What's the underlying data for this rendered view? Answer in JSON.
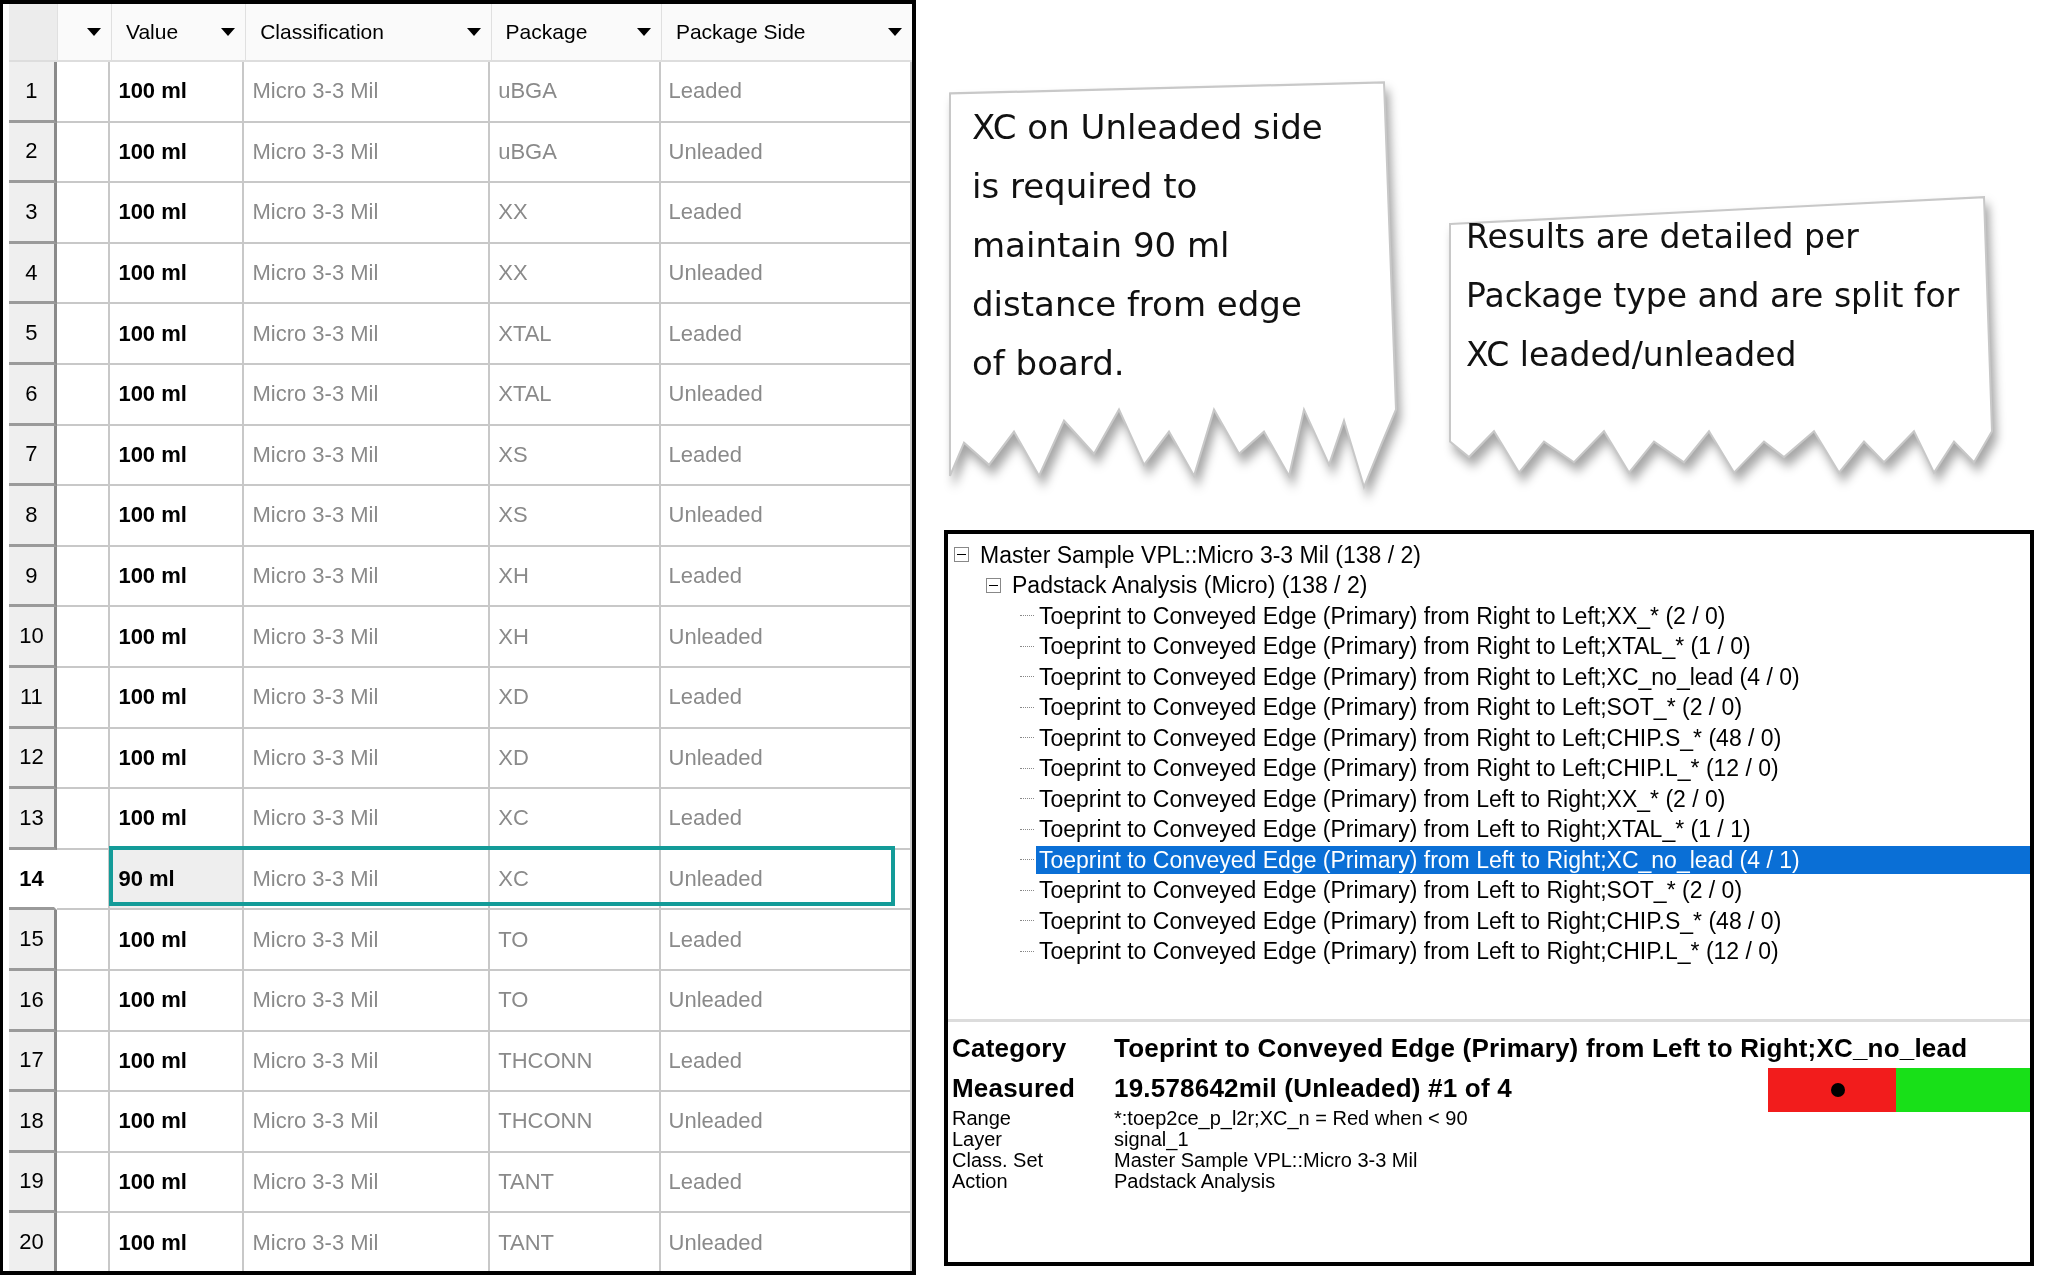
{
  "table": {
    "columns": [
      {
        "label": "Value"
      },
      {
        "label": "Classification"
      },
      {
        "label": "Package"
      },
      {
        "label": "Package Side"
      }
    ],
    "rows": [
      {
        "number": "1",
        "value": "100 ml",
        "classification": "Micro 3-3 Mil",
        "package": "uBGA",
        "side": "Leaded",
        "selected": false
      },
      {
        "number": "2",
        "value": "100 ml",
        "classification": "Micro 3-3 Mil",
        "package": "uBGA",
        "side": "Unleaded",
        "selected": false
      },
      {
        "number": "3",
        "value": "100 ml",
        "classification": "Micro 3-3 Mil",
        "package": "XX",
        "side": "Leaded",
        "selected": false
      },
      {
        "number": "4",
        "value": "100 ml",
        "classification": "Micro 3-3 Mil",
        "package": "XX",
        "side": "Unleaded",
        "selected": false
      },
      {
        "number": "5",
        "value": "100 ml",
        "classification": "Micro 3-3 Mil",
        "package": "XTAL",
        "side": "Leaded",
        "selected": false
      },
      {
        "number": "6",
        "value": "100 ml",
        "classification": "Micro 3-3 Mil",
        "package": "XTAL",
        "side": "Unleaded",
        "selected": false
      },
      {
        "number": "7",
        "value": "100 ml",
        "classification": "Micro 3-3 Mil",
        "package": "XS",
        "side": "Leaded",
        "selected": false
      },
      {
        "number": "8",
        "value": "100 ml",
        "classification": "Micro 3-3 Mil",
        "package": "XS",
        "side": "Unleaded",
        "selected": false
      },
      {
        "number": "9",
        "value": "100 ml",
        "classification": "Micro 3-3 Mil",
        "package": "XH",
        "side": "Leaded",
        "selected": false
      },
      {
        "number": "10",
        "value": "100 ml",
        "classification": "Micro 3-3 Mil",
        "package": "XH",
        "side": "Unleaded",
        "selected": false
      },
      {
        "number": "11",
        "value": "100 ml",
        "classification": "Micro 3-3 Mil",
        "package": "XD",
        "side": "Leaded",
        "selected": false
      },
      {
        "number": "12",
        "value": "100 ml",
        "classification": "Micro 3-3 Mil",
        "package": "XD",
        "side": "Unleaded",
        "selected": false
      },
      {
        "number": "13",
        "value": "100 ml",
        "classification": "Micro 3-3 Mil",
        "package": "XC",
        "side": "Leaded",
        "selected": false
      },
      {
        "number": "14",
        "value": "90 ml",
        "classification": "Micro 3-3 Mil",
        "package": "XC",
        "side": "Unleaded",
        "selected": true,
        "outlined": true
      },
      {
        "number": "15",
        "value": "100 ml",
        "classification": "Micro 3-3 Mil",
        "package": "TO",
        "side": "Leaded",
        "selected": false
      },
      {
        "number": "16",
        "value": "100 ml",
        "classification": "Micro 3-3 Mil",
        "package": "TO",
        "side": "Unleaded",
        "selected": false
      },
      {
        "number": "17",
        "value": "100 ml",
        "classification": "Micro 3-3 Mil",
        "package": "THCONN",
        "side": "Leaded",
        "selected": false
      },
      {
        "number": "18",
        "value": "100 ml",
        "classification": "Micro 3-3 Mil",
        "package": "THCONN",
        "side": "Unleaded",
        "selected": false
      },
      {
        "number": "19",
        "value": "100 ml",
        "classification": "Micro 3-3 Mil",
        "package": "TANT",
        "side": "Leaded",
        "selected": false
      },
      {
        "number": "20",
        "value": "100 ml",
        "classification": "Micro 3-3 Mil",
        "package": "TANT",
        "side": "Unleaded",
        "selected": false
      }
    ]
  },
  "callouts": [
    {
      "text": "XC on Unleaded side is required to maintain 90 ml distance from edge of board."
    },
    {
      "text": "Results are detailed per Package type and are split for XC leaded/unleaded"
    }
  ],
  "tree": [
    {
      "label": "Master Sample VPL::Micro 3-3 Mil (138 / 2)",
      "expanded": true,
      "children": [
        {
          "label": "Padstack Analysis (Micro) (138 / 2)",
          "expanded": true,
          "children": [
            {
              "label": "Toeprint to Conveyed Edge (Primary) from Right to Left;XX_* (2 / 0)",
              "selected": false
            },
            {
              "label": "Toeprint to Conveyed Edge (Primary) from Right to Left;XTAL_* (1 / 0)",
              "selected": false
            },
            {
              "label": "Toeprint to Conveyed Edge (Primary) from Right to Left;XC_no_lead (4 / 0)",
              "selected": false
            },
            {
              "label": "Toeprint to Conveyed Edge (Primary) from Right to Left;SOT_* (2 / 0)",
              "selected": false
            },
            {
              "label": "Toeprint to Conveyed Edge (Primary) from Right to Left;CHIP.S_* (48 / 0)",
              "selected": false
            },
            {
              "label": "Toeprint to Conveyed Edge (Primary) from Right to Left;CHIP.L_* (12 / 0)",
              "selected": false
            },
            {
              "label": "Toeprint to Conveyed Edge (Primary) from Left to Right;XX_* (2 / 0)",
              "selected": false
            },
            {
              "label": "Toeprint to Conveyed Edge (Primary) from Left to Right;XTAL_* (1 / 1)",
              "selected": false
            },
            {
              "label": "Toeprint to Conveyed Edge (Primary) from Left to Right;XC_no_lead (4 / 1)",
              "selected": true
            },
            {
              "label": "Toeprint to Conveyed Edge (Primary) from Left to Right;SOT_* (2 / 0)",
              "selected": false
            },
            {
              "label": "Toeprint to Conveyed Edge (Primary) from Left to Right;CHIP.S_* (48 / 0)",
              "selected": false
            },
            {
              "label": "Toeprint to Conveyed Edge (Primary) from Left to Right;CHIP.L_* (12 / 0)",
              "selected": false
            }
          ]
        }
      ]
    }
  ],
  "details": {
    "main": [
      {
        "label": "Category",
        "value": "Toeprint to Conveyed Edge (Primary) from Left to Right;XC_no_lead"
      },
      {
        "label": "Measured",
        "value": "19.578642mil (Unleaded) #1 of 4"
      }
    ],
    "info": [
      {
        "label": "Range",
        "value": "*:toep2ce_p_l2r;XC_n = Red when < 90"
      },
      {
        "label": "Layer",
        "value": "signal_1"
      },
      {
        "label": "Class. Set",
        "value": "Master Sample VPL::Micro 3-3 Mil"
      },
      {
        "label": "Action",
        "value": "Padstack Analysis"
      }
    ]
  }
}
